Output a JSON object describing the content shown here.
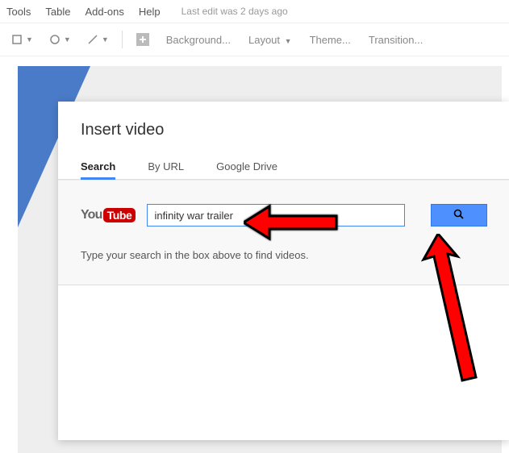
{
  "menu": {
    "items": [
      "Tools",
      "Table",
      "Add-ons",
      "Help"
    ],
    "edit_status": "Last edit was 2 days ago"
  },
  "toolbar": {
    "background": "Background...",
    "layout": "Layout",
    "theme": "Theme...",
    "transition": "Transition..."
  },
  "dialog": {
    "title": "Insert video",
    "tabs": [
      "Search",
      "By URL",
      "Google Drive"
    ],
    "youtube_you": "You",
    "youtube_tube": "Tube",
    "search_value": "infinity war trailer",
    "search_hint": "Type your search in the box above to find videos."
  }
}
